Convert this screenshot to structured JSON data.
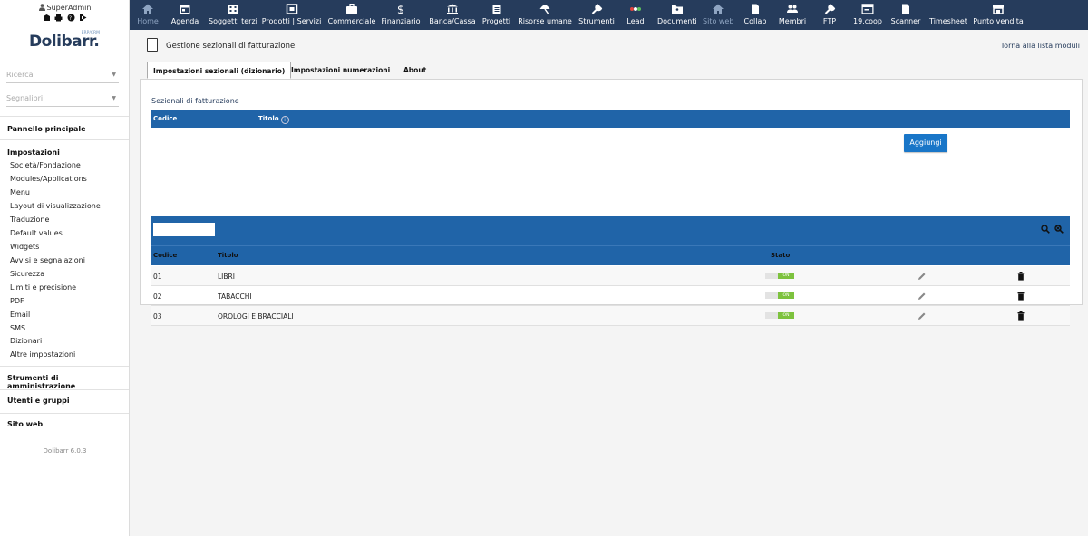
{
  "user": {
    "name": "SuperAdmin",
    "tools": "🏛 🖶 ? ↪"
  },
  "logo": {
    "text": "Dolibarr.",
    "sub": "ERP/CRM"
  },
  "sidebar": {
    "search_placeholder": "Ricerca",
    "bookmarks_placeholder": "Segnalibri",
    "home": "Pannello principale",
    "setup_head": "Impostazioni",
    "setup_items": [
      "Società/Fondazione",
      "Modules/Applications",
      "Menu",
      "Layout di visualizzazione",
      "Traduzione",
      "Default values",
      "Widgets",
      "Avvisi e segnalazioni",
      "Sicurezza",
      "Limiti e precisione",
      "PDF",
      "Email",
      "SMS",
      "Dizionari",
      "Altre impostazioni"
    ],
    "admin_tools": "Strumenti di amministrazione",
    "users_groups": "Utenti e gruppi",
    "website": "Sito web",
    "version": "Dolibarr 6.0.3"
  },
  "topmenu": [
    {
      "label": "Home",
      "icon": "home-icon",
      "dim": true
    },
    {
      "label": "Agenda",
      "icon": "calendar-icon"
    },
    {
      "label": "Soggetti terzi",
      "icon": "building-icon"
    },
    {
      "label": "Prodotti | Servizi",
      "icon": "cube-icon"
    },
    {
      "label": "Commerciale",
      "icon": "briefcase-icon"
    },
    {
      "label": "Finanziario",
      "icon": "dollar-icon"
    },
    {
      "label": "Banca/Cassa",
      "icon": "bank-icon"
    },
    {
      "label": "Progetti",
      "icon": "clipboard-icon"
    },
    {
      "label": "Risorse umane",
      "icon": "umbrella-icon"
    },
    {
      "label": "Strumenti",
      "icon": "wrench-icon"
    },
    {
      "label": "Lead",
      "icon": "lead-icon"
    },
    {
      "label": "Documenti",
      "icon": "folder-icon"
    },
    {
      "label": "Sito web",
      "icon": "home-icon",
      "dim": true
    },
    {
      "label": "Collab",
      "icon": "document-icon"
    },
    {
      "label": "Membri",
      "icon": "people-icon"
    },
    {
      "label": "FTP",
      "icon": "wrench-icon"
    },
    {
      "label": "19.coop",
      "icon": "window-icon"
    },
    {
      "label": "Scanner",
      "icon": "document-icon"
    },
    {
      "label": "Timesheet",
      "icon": "blank-icon"
    },
    {
      "label": "Punto vendita",
      "icon": "store-icon"
    }
  ],
  "page": {
    "title": "Gestione sezionali di fatturazione",
    "back_link": "Torna alla lista moduli",
    "tabs": [
      "Impostazioni sezionali (dizionario)",
      "Impostazioni numerazioni",
      "About"
    ],
    "section_title": "Sezionali di fatturazione",
    "form_headers": {
      "code": "Codice",
      "title": "Titolo"
    },
    "add_button": "Aggiungi",
    "list_headers": {
      "code": "Codice",
      "title": "Titolo",
      "status": "Stato"
    },
    "toggle_on_label": "ON",
    "rows": [
      {
        "code": "01",
        "title": "LIBRI",
        "status": "ON"
      },
      {
        "code": "02",
        "title": "TABACCHI",
        "status": "ON"
      },
      {
        "code": "03",
        "title": "OROLOGI E BRACCIALI",
        "status": "ON"
      }
    ]
  },
  "colors": {
    "topbar": "#263c5c",
    "table_header": "#2064a8",
    "button": "#1976c8",
    "toggle_on": "#7dc23e"
  }
}
